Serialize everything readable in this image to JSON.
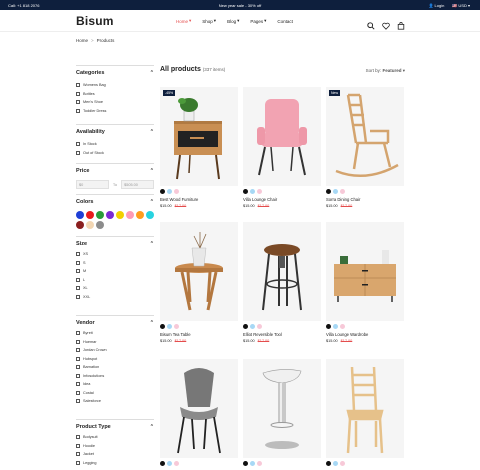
{
  "topbar": {
    "phone": "Call: +1 818 2076",
    "promo": "New year sale - 30% off",
    "login": "Login",
    "currency": "USD"
  },
  "header": {
    "logo": "Bisum",
    "nav": [
      "Home",
      "Shop",
      "Blog",
      "Pages",
      "Contact"
    ]
  },
  "breadcrumb": {
    "home": "Home",
    "sep": ">",
    "current": "Products"
  },
  "sidebar": {
    "categories": {
      "title": "Categories",
      "items": [
        "Womens Bag",
        "Bottles",
        "Men's Shoe",
        "Toddler Dress"
      ]
    },
    "availability": {
      "title": "Availability",
      "items": [
        "In Stock",
        "Out of Stock"
      ]
    },
    "price": {
      "title": "Price",
      "from": "$0",
      "to_label": "To",
      "to": "$505.00"
    },
    "colors": {
      "title": "Colors",
      "swatches": [
        "#1f3fd6",
        "#e81c1c",
        "#2a9d3a",
        "#7b2bd4",
        "#f2d000",
        "#ff9bb6",
        "#ff9d1f",
        "#28d3e0",
        "#8b1f1f",
        "#f2d6b3",
        "#8c8c8c"
      ]
    },
    "size": {
      "title": "Size",
      "items": [
        "XS",
        "S",
        "M",
        "L",
        "XL",
        "XXL"
      ]
    },
    "vendor": {
      "title": "Vendor",
      "items": [
        "Byreit",
        "Huemar",
        "Jordan Crown",
        "Hubspot",
        "Barnation",
        "Infosolutions",
        "Idea",
        "Costal",
        "Salesforce"
      ]
    },
    "product_type": {
      "title": "Product Type",
      "items": [
        "Bodysuit",
        "Hoodie",
        "Jacket",
        "Legging"
      ]
    }
  },
  "main": {
    "title": "All products",
    "count": "(337 items)",
    "sort_label": "Sort by:",
    "sort_value": "Featured"
  },
  "products": [
    {
      "name": "Best Wood Furniture",
      "price": "$15.00",
      "old": "$17.00",
      "badge": "-45%",
      "dots": [
        "#111",
        "#a7d8f5",
        "#f7c9d8"
      ]
    },
    {
      "name": "Villa Lounge Chair",
      "price": "$15.00",
      "old": "$17.00",
      "badge": "",
      "dots": [
        "#111",
        "#a7d8f5",
        "#f7c9d8"
      ]
    },
    {
      "name": "Sorra Dining Chair",
      "price": "$15.00",
      "old": "$17.00",
      "badge": "New",
      "dots": [
        "#111",
        "#a7d8f5",
        "#f7c9d8"
      ]
    },
    {
      "name": "Bisum Tea Table",
      "price": "$15.00",
      "old": "$17.00",
      "badge": "",
      "dots": [
        "#111",
        "#a7d8f5",
        "#f7c9d8"
      ]
    },
    {
      "name": "Elliot Reversible Tool",
      "price": "$15.00",
      "old": "$17.00",
      "badge": "",
      "dots": [
        "#111",
        "#a7d8f5",
        "#f7c9d8"
      ]
    },
    {
      "name": "Villa Lounge Wardrobe",
      "price": "$15.00",
      "old": "$17.00",
      "badge": "",
      "dots": [
        "#111",
        "#a7d8f5",
        "#f7c9d8"
      ]
    },
    {
      "name": "",
      "price": "",
      "old": "",
      "badge": "",
      "dots": [
        "#111",
        "#a7d8f5",
        "#f7c9d8"
      ]
    },
    {
      "name": "",
      "price": "",
      "old": "",
      "badge": "",
      "dots": [
        "#111",
        "#a7d8f5",
        "#f7c9d8"
      ]
    },
    {
      "name": "",
      "price": "",
      "old": "",
      "badge": "",
      "dots": [
        "#111",
        "#a7d8f5",
        "#f7c9d8"
      ]
    }
  ]
}
